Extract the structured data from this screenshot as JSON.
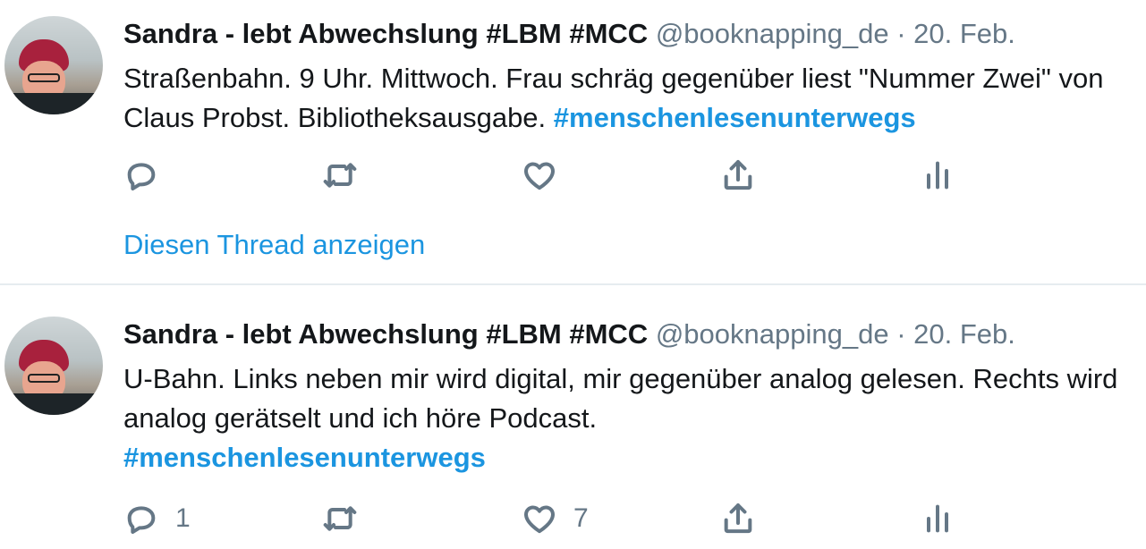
{
  "tweets": [
    {
      "name": "Sandra - lebt Abwechslung #LBM #MCC",
      "handle": "@booknapping_de",
      "separator": "·",
      "date": "20. Feb.",
      "text": "Straßenbahn. 9 Uhr. Mittwoch. Frau schräg gegenüber liest \"Nummer Zwei\" von Claus Probst. Bibliotheksausgabe.",
      "hashtag": "#menschenlesenunterwegs",
      "reply_count": "",
      "retweet_count": "",
      "like_count": "",
      "thread_link": "Diesen Thread anzeigen"
    },
    {
      "name": "Sandra - lebt Abwechslung #LBM #MCC",
      "handle": "@booknapping_de",
      "separator": "·",
      "date": "20. Feb.",
      "text": "U-Bahn. Links neben mir wird digital, mir gegenüber analog gelesen. Rechts wird analog gerätselt und ich höre Podcast.",
      "hashtag": "#menschenlesenunterwegs",
      "reply_count": "1",
      "retweet_count": "",
      "like_count": "7"
    }
  ],
  "colors": {
    "link": "#1b95e0",
    "muted": "#657786",
    "divider": "#e6ecf0"
  },
  "icons": [
    "reply-icon",
    "retweet-icon",
    "like-icon",
    "share-icon",
    "analytics-icon"
  ]
}
